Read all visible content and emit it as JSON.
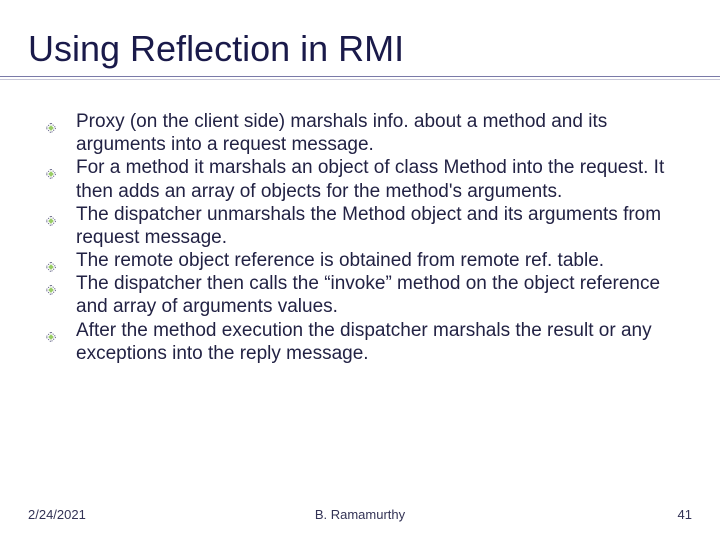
{
  "slide": {
    "title": "Using Reflection in RMI",
    "bullets": [
      "Proxy (on the client side) marshals info. about a method and its arguments into a request message.",
      "For a method it marshals an object of class Method into the request. It then adds an array of objects for the method's arguments.",
      "The dispatcher unmarshals the Method object and its arguments from request message.",
      "The remote object reference is obtained from remote ref. table.",
      "The dispatcher then calls the “invoke” method on the object reference and array of arguments values.",
      "After the method execution the dispatcher marshals the result or any exceptions into the reply message."
    ]
  },
  "footer": {
    "date": "2/24/2021",
    "author": "B. Ramamurthy",
    "page": "41"
  },
  "icons": {
    "bullet": "diamond-dotted-icon"
  },
  "colors": {
    "title": "#1a1a4a",
    "text": "#222244",
    "bullet_outline": "#666688",
    "bullet_fill": "#99cc66"
  }
}
